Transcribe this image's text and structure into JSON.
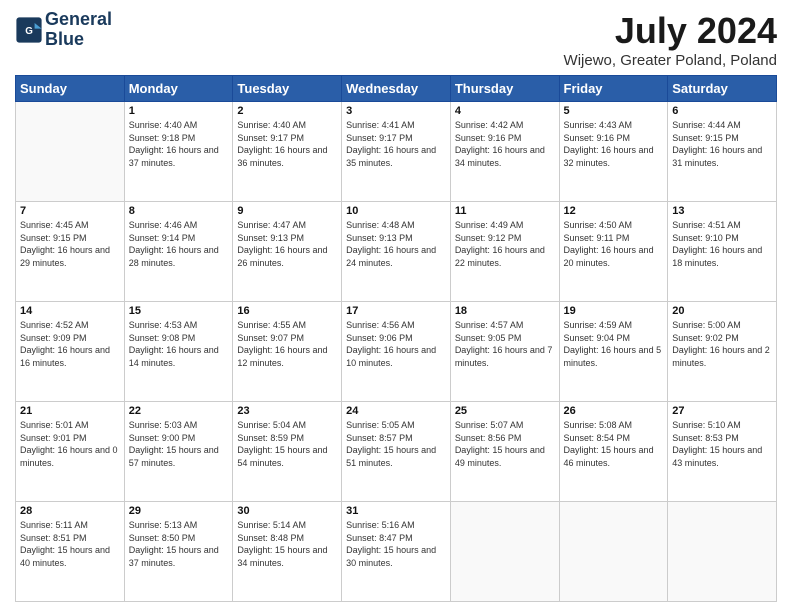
{
  "header": {
    "logo_line1": "General",
    "logo_line2": "Blue",
    "title": "July 2024",
    "subtitle": "Wijewo, Greater Poland, Poland"
  },
  "days_of_week": [
    "Sunday",
    "Monday",
    "Tuesday",
    "Wednesday",
    "Thursday",
    "Friday",
    "Saturday"
  ],
  "weeks": [
    [
      {
        "day": "",
        "info": ""
      },
      {
        "day": "1",
        "info": "Sunrise: 4:40 AM\nSunset: 9:18 PM\nDaylight: 16 hours and 37 minutes."
      },
      {
        "day": "2",
        "info": "Sunrise: 4:40 AM\nSunset: 9:17 PM\nDaylight: 16 hours and 36 minutes."
      },
      {
        "day": "3",
        "info": "Sunrise: 4:41 AM\nSunset: 9:17 PM\nDaylight: 16 hours and 35 minutes."
      },
      {
        "day": "4",
        "info": "Sunrise: 4:42 AM\nSunset: 9:16 PM\nDaylight: 16 hours and 34 minutes."
      },
      {
        "day": "5",
        "info": "Sunrise: 4:43 AM\nSunset: 9:16 PM\nDaylight: 16 hours and 32 minutes."
      },
      {
        "day": "6",
        "info": "Sunrise: 4:44 AM\nSunset: 9:15 PM\nDaylight: 16 hours and 31 minutes."
      }
    ],
    [
      {
        "day": "7",
        "info": "Sunrise: 4:45 AM\nSunset: 9:15 PM\nDaylight: 16 hours and 29 minutes."
      },
      {
        "day": "8",
        "info": "Sunrise: 4:46 AM\nSunset: 9:14 PM\nDaylight: 16 hours and 28 minutes."
      },
      {
        "day": "9",
        "info": "Sunrise: 4:47 AM\nSunset: 9:13 PM\nDaylight: 16 hours and 26 minutes."
      },
      {
        "day": "10",
        "info": "Sunrise: 4:48 AM\nSunset: 9:13 PM\nDaylight: 16 hours and 24 minutes."
      },
      {
        "day": "11",
        "info": "Sunrise: 4:49 AM\nSunset: 9:12 PM\nDaylight: 16 hours and 22 minutes."
      },
      {
        "day": "12",
        "info": "Sunrise: 4:50 AM\nSunset: 9:11 PM\nDaylight: 16 hours and 20 minutes."
      },
      {
        "day": "13",
        "info": "Sunrise: 4:51 AM\nSunset: 9:10 PM\nDaylight: 16 hours and 18 minutes."
      }
    ],
    [
      {
        "day": "14",
        "info": "Sunrise: 4:52 AM\nSunset: 9:09 PM\nDaylight: 16 hours and 16 minutes."
      },
      {
        "day": "15",
        "info": "Sunrise: 4:53 AM\nSunset: 9:08 PM\nDaylight: 16 hours and 14 minutes."
      },
      {
        "day": "16",
        "info": "Sunrise: 4:55 AM\nSunset: 9:07 PM\nDaylight: 16 hours and 12 minutes."
      },
      {
        "day": "17",
        "info": "Sunrise: 4:56 AM\nSunset: 9:06 PM\nDaylight: 16 hours and 10 minutes."
      },
      {
        "day": "18",
        "info": "Sunrise: 4:57 AM\nSunset: 9:05 PM\nDaylight: 16 hours and 7 minutes."
      },
      {
        "day": "19",
        "info": "Sunrise: 4:59 AM\nSunset: 9:04 PM\nDaylight: 16 hours and 5 minutes."
      },
      {
        "day": "20",
        "info": "Sunrise: 5:00 AM\nSunset: 9:02 PM\nDaylight: 16 hours and 2 minutes."
      }
    ],
    [
      {
        "day": "21",
        "info": "Sunrise: 5:01 AM\nSunset: 9:01 PM\nDaylight: 16 hours and 0 minutes."
      },
      {
        "day": "22",
        "info": "Sunrise: 5:03 AM\nSunset: 9:00 PM\nDaylight: 15 hours and 57 minutes."
      },
      {
        "day": "23",
        "info": "Sunrise: 5:04 AM\nSunset: 8:59 PM\nDaylight: 15 hours and 54 minutes."
      },
      {
        "day": "24",
        "info": "Sunrise: 5:05 AM\nSunset: 8:57 PM\nDaylight: 15 hours and 51 minutes."
      },
      {
        "day": "25",
        "info": "Sunrise: 5:07 AM\nSunset: 8:56 PM\nDaylight: 15 hours and 49 minutes."
      },
      {
        "day": "26",
        "info": "Sunrise: 5:08 AM\nSunset: 8:54 PM\nDaylight: 15 hours and 46 minutes."
      },
      {
        "day": "27",
        "info": "Sunrise: 5:10 AM\nSunset: 8:53 PM\nDaylight: 15 hours and 43 minutes."
      }
    ],
    [
      {
        "day": "28",
        "info": "Sunrise: 5:11 AM\nSunset: 8:51 PM\nDaylight: 15 hours and 40 minutes."
      },
      {
        "day": "29",
        "info": "Sunrise: 5:13 AM\nSunset: 8:50 PM\nDaylight: 15 hours and 37 minutes."
      },
      {
        "day": "30",
        "info": "Sunrise: 5:14 AM\nSunset: 8:48 PM\nDaylight: 15 hours and 34 minutes."
      },
      {
        "day": "31",
        "info": "Sunrise: 5:16 AM\nSunset: 8:47 PM\nDaylight: 15 hours and 30 minutes."
      },
      {
        "day": "",
        "info": ""
      },
      {
        "day": "",
        "info": ""
      },
      {
        "day": "",
        "info": ""
      }
    ]
  ]
}
